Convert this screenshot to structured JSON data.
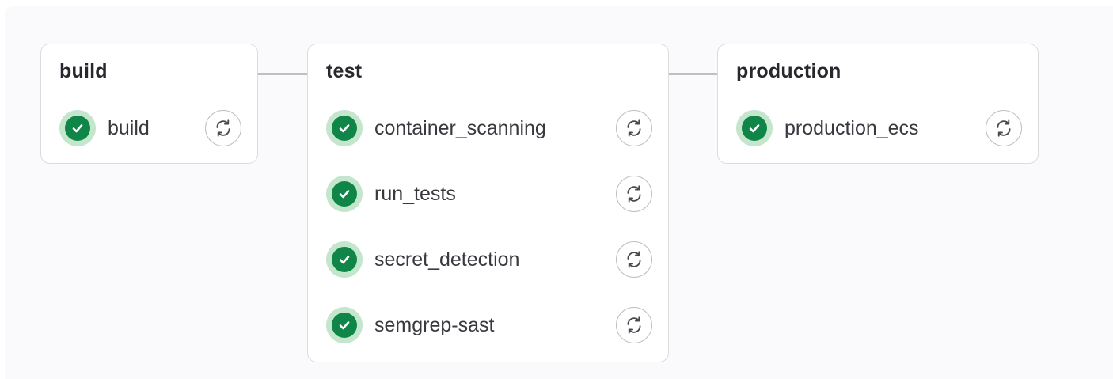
{
  "pipeline": {
    "stages": [
      {
        "title": "build",
        "jobs": [
          {
            "name": "build",
            "status": "success",
            "status_icon": "check-circle-icon",
            "action_icon": "retry-icon"
          }
        ]
      },
      {
        "title": "test",
        "jobs": [
          {
            "name": "container_scanning",
            "status": "success",
            "status_icon": "check-circle-icon",
            "action_icon": "retry-icon"
          },
          {
            "name": "run_tests",
            "status": "success",
            "status_icon": "check-circle-icon",
            "action_icon": "retry-icon"
          },
          {
            "name": "secret_detection",
            "status": "success",
            "status_icon": "check-circle-icon",
            "action_icon": "retry-icon"
          },
          {
            "name": "semgrep-sast",
            "status": "success",
            "status_icon": "check-circle-icon",
            "action_icon": "retry-icon"
          }
        ]
      },
      {
        "title": "production",
        "jobs": [
          {
            "name": "production_ecs",
            "status": "success",
            "status_icon": "check-circle-icon",
            "action_icon": "retry-icon"
          }
        ]
      }
    ]
  },
  "colors": {
    "success": "#108548",
    "success_halo": "#c3e6cd",
    "border": "#dcdcde",
    "connector": "#bfbfc3",
    "canvas": "#fafafc"
  }
}
